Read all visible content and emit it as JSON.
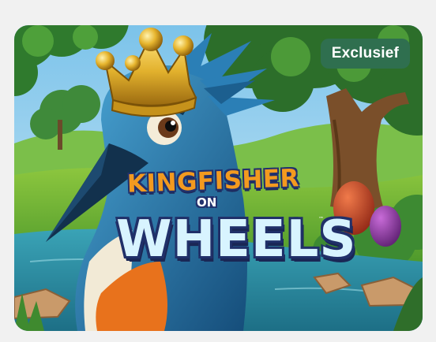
{
  "card": {
    "badge_label": "Exclusief",
    "logo": {
      "line1": "KINGFISHER",
      "line2": "ON",
      "line3": "WHEELS",
      "trademark": "™"
    }
  },
  "colors": {
    "page_background": "#f1f1f1",
    "badge_background": "#2f6f4f",
    "badge_text": "#ffffff",
    "logo_orange": "#f39a1f",
    "logo_navy": "#21316d",
    "logo_light_blue": "#d8f4ff",
    "bird_blue": "#1f6fa5",
    "crown_gold": "#d9a81c"
  }
}
